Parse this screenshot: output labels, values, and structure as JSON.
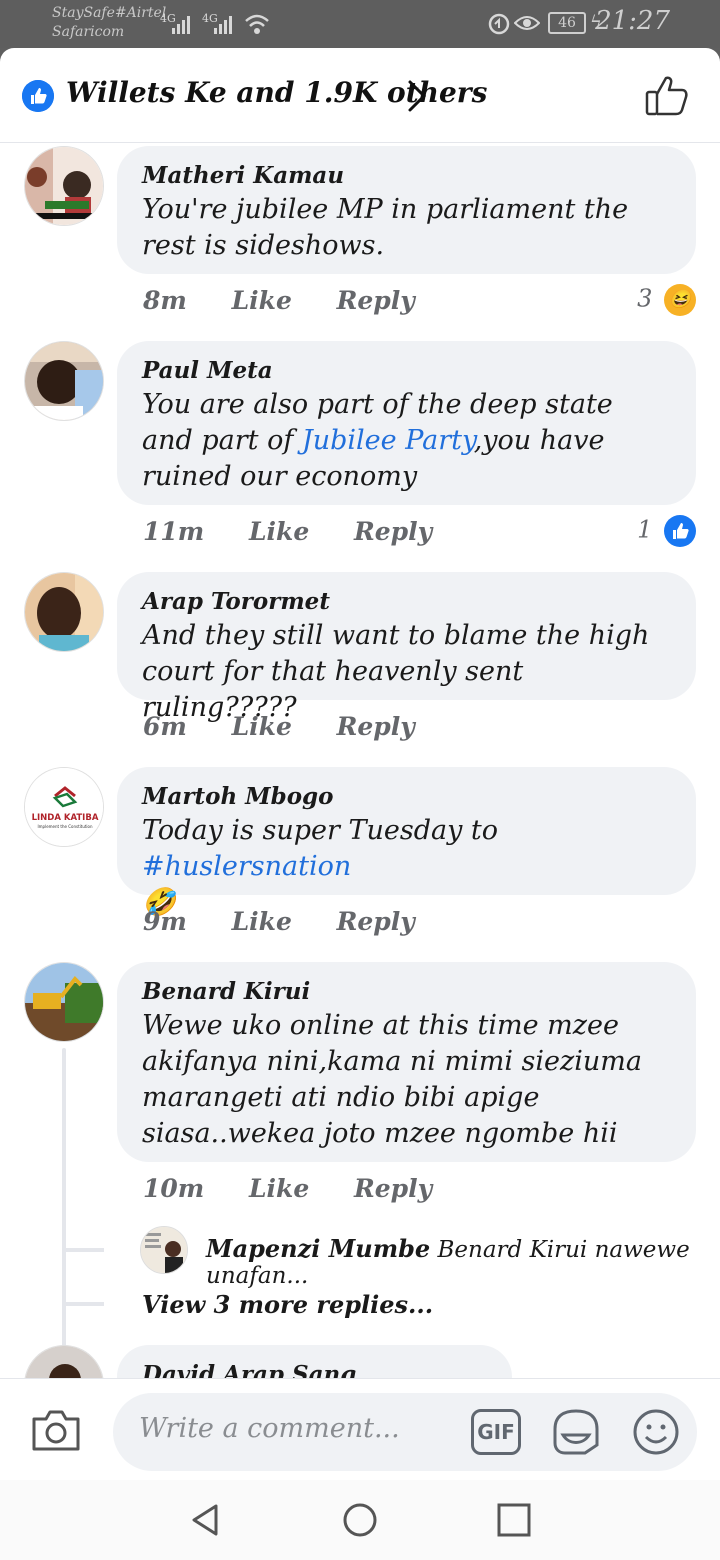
{
  "status_bar": {
    "carrier_line1": "StaySafe#Airtel",
    "carrier_line2": "Safaricom",
    "signal1": "4G",
    "signal2": "4G",
    "battery": "46",
    "time": "21:27"
  },
  "header": {
    "reactions_summary": "Willets Ke and 1.9K others"
  },
  "comments": [
    {
      "author": "Matheri Kamau",
      "text": "You're jubilee MP in parliament the rest is sideshows.",
      "time": "8m",
      "like_label": "Like",
      "reply_label": "Reply",
      "reaction_count": "3",
      "reaction_icon": "haha-icon"
    },
    {
      "author": "Paul Meta",
      "text_before": "You are also part of the deep state and part of ",
      "text_link": "Jubilee Party",
      "text_after": ",you have ruined our economy",
      "time": "11m",
      "like_label": "Like",
      "reply_label": "Reply",
      "reaction_count": "1",
      "reaction_icon": "like-icon"
    },
    {
      "author": "Arap Torormet",
      "text": "And they still want to blame the high court for that heavenly sent ruling?????",
      "time": "6m",
      "like_label": "Like",
      "reply_label": "Reply"
    },
    {
      "author": "Martoh Mbogo",
      "text_before": "Today is super Tuesday to ",
      "text_link": "#huslersnation",
      "emoji": "🤣",
      "avatar_text": "LINDA KATIBA",
      "avatar_subtext": "Implement the Constitution",
      "time": "9m",
      "like_label": "Like",
      "reply_label": "Reply"
    },
    {
      "author": "Benard Kirui",
      "text": "Wewe uko online at this time mzee akifanya nini,kama ni mimi sieziuma marangeti ati ndio bibi apige siasa..wekea joto mzee ngombe hii",
      "time": "10m",
      "like_label": "Like",
      "reply_label": "Reply",
      "reply_preview": {
        "author": "Mapenzi Mumbe",
        "text": "Benard Kirui nawewe unafan..."
      },
      "view_more": "View 3 more replies..."
    },
    {
      "author": "David Arap Sang"
    }
  ],
  "composer": {
    "placeholder": "Write a comment...",
    "gif_label": "GIF"
  }
}
